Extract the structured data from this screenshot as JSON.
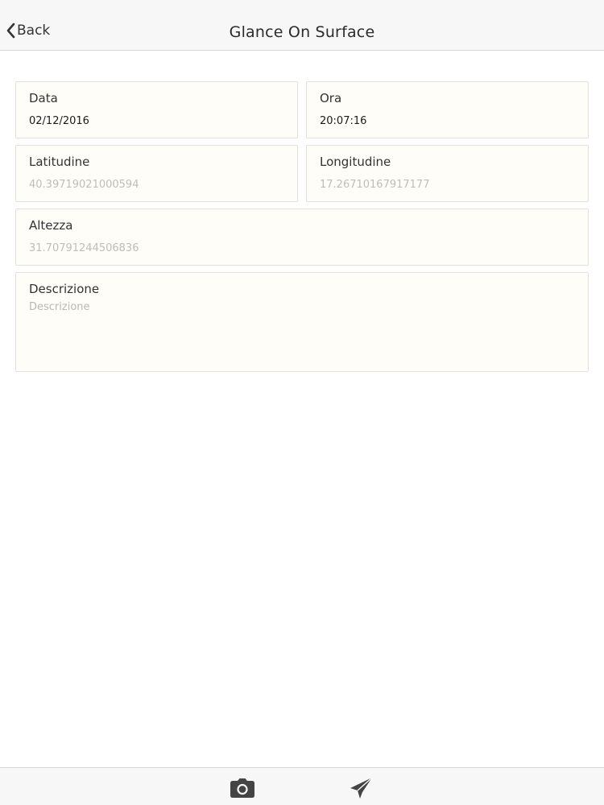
{
  "navbar": {
    "back_label": "Back",
    "title": "Glance On Surface"
  },
  "form": {
    "data": {
      "label": "Data",
      "value": "02/12/2016"
    },
    "ora": {
      "label": "Ora",
      "value": "20:07:16"
    },
    "latitudine": {
      "label": "Latitudine",
      "placeholder": "40.39719021000594"
    },
    "longitudine": {
      "label": "Longitudine",
      "placeholder": "17.26710167917177"
    },
    "altezza": {
      "label": "Altezza",
      "placeholder": "31.70791244506836"
    },
    "descrizione": {
      "label": "Descrizione",
      "placeholder": "Descrizione"
    }
  },
  "toolbar": {
    "camera_icon": "camera-icon",
    "send_icon": "paper-plane-icon"
  }
}
